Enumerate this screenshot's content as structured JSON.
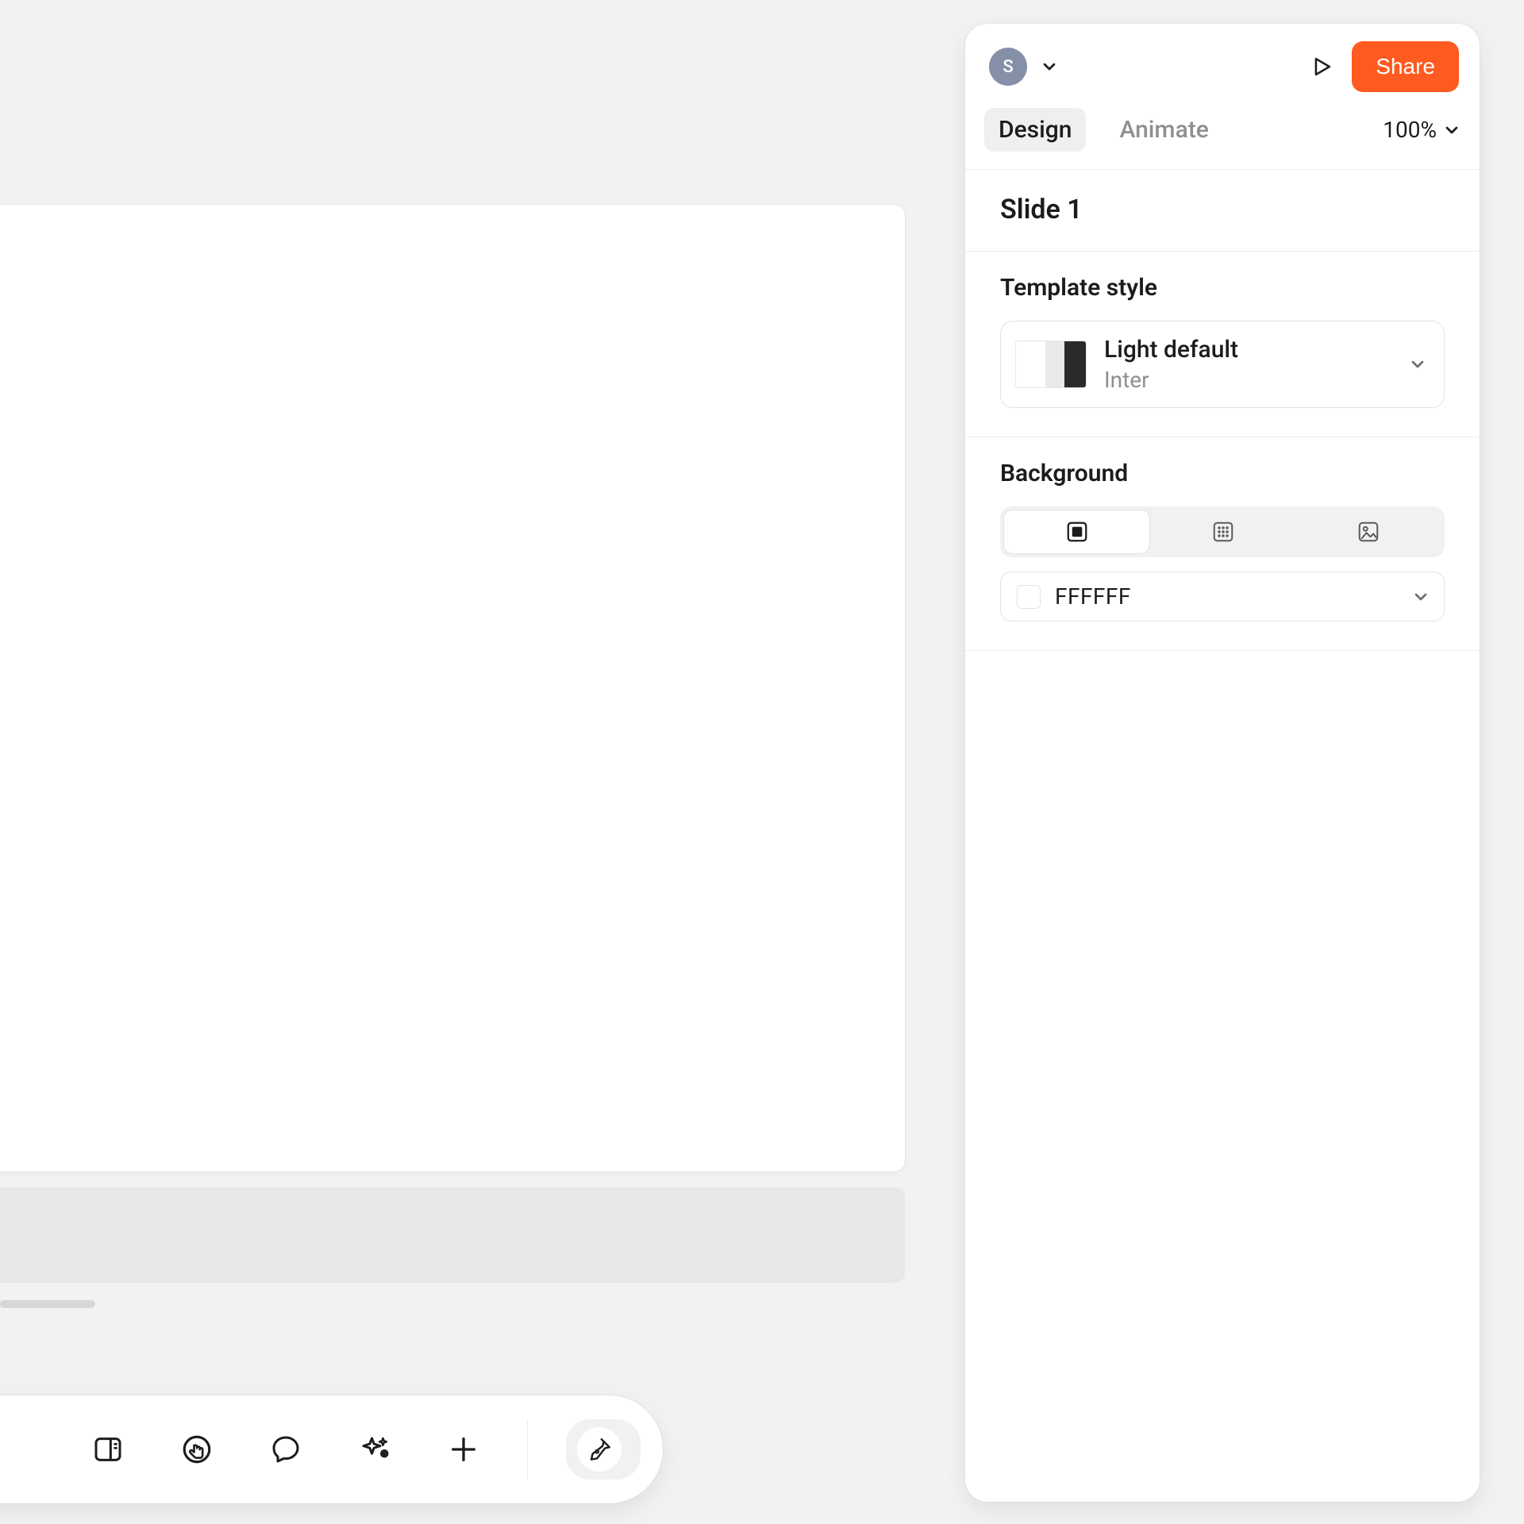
{
  "header": {
    "avatar_letter": "S",
    "share_label": "Share"
  },
  "tabs": {
    "design": "Design",
    "animate": "Animate",
    "active": "design"
  },
  "zoom": {
    "value": "100%"
  },
  "slide": {
    "title": "Slide 1"
  },
  "template": {
    "section_label": "Template style",
    "name": "Light default",
    "font": "Inter"
  },
  "background": {
    "section_label": "Background",
    "color_hex": "FFFFFF",
    "tabs": [
      "solid",
      "pattern",
      "image"
    ],
    "active_tab": "solid"
  },
  "toolbar": {
    "items": [
      "panel",
      "hand",
      "comment",
      "ai",
      "add",
      "pen"
    ]
  }
}
